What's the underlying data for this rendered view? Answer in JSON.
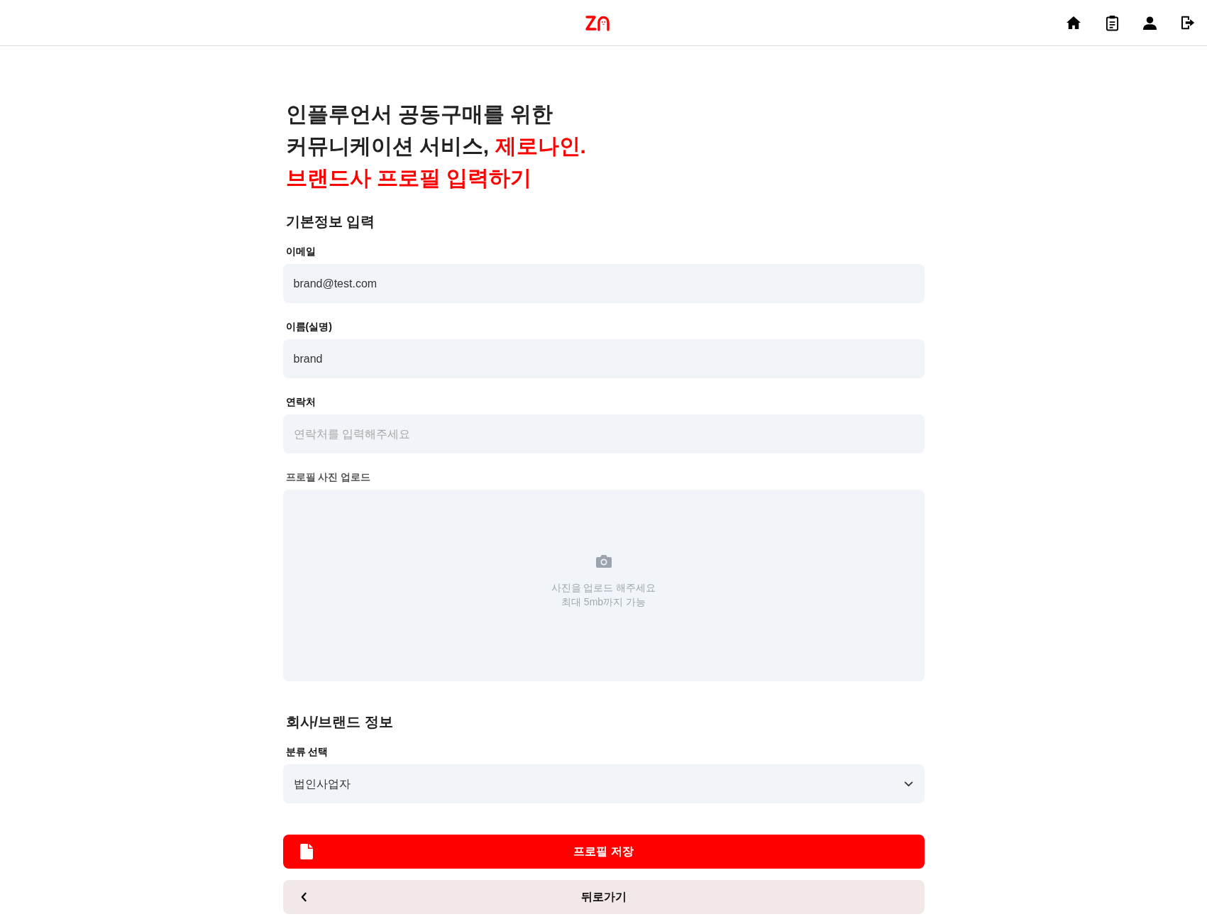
{
  "title_lines": [
    [
      {
        "text": "인플루언서 공동구매를 위한",
        "accent": false
      }
    ],
    [
      {
        "text": "커뮤니케이션 서비스,",
        "accent": false
      },
      {
        "text": "제로나인.",
        "accent": true
      }
    ],
    [
      {
        "text": "브랜드사 프로필 입력하기",
        "accent": true
      }
    ]
  ],
  "sections": [
    {
      "title": "기본정보 입력",
      "fields": [
        {
          "kind": "text",
          "label": "이메일",
          "value": "brand@test.com"
        },
        {
          "kind": "text",
          "label": "이름(실명)",
          "value": "brand"
        },
        {
          "kind": "text",
          "label": "연락처",
          "placeholder": "연락처를 입력해주세요"
        },
        {
          "kind": "upload",
          "label": "프로필 사진 업로드",
          "hint_lines": [
            "사진을 업로드 해주세요",
            "최대 5mb까지 가능"
          ]
        }
      ]
    },
    {
      "title": "회사/브랜드 정보",
      "fields": [
        {
          "kind": "select",
          "label": "분류 선택",
          "value": "법인사업자"
        }
      ]
    }
  ],
  "actions": [
    {
      "kind": "primary",
      "label": "프로필 저장"
    },
    {
      "kind": "back",
      "label": "뒤로가기"
    }
  ]
}
